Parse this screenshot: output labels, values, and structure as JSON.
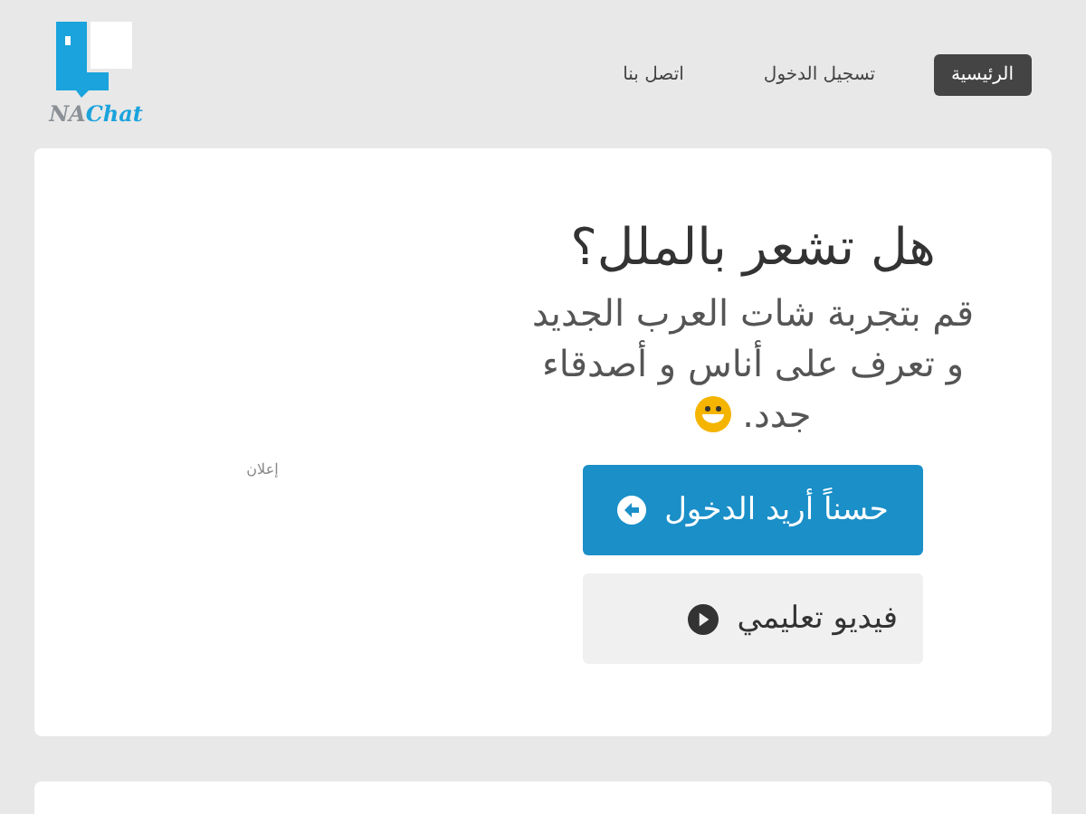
{
  "logo": {
    "prefix": "NA",
    "name": "Chat"
  },
  "nav": [
    {
      "label": "الرئيسية",
      "selected": true
    },
    {
      "label": "تسجيل الدخول",
      "selected": false
    },
    {
      "label": "اتصل بنا",
      "selected": false
    }
  ],
  "hero": {
    "title": "هل تشعر بالملل؟",
    "subtitle": "قم بتجربة شات العرب الجديد و تعرف على أناس و أصدقاء جدد.",
    "ad_label": "إعلان",
    "buttons": [
      {
        "label": "حسناً أريد الدخول",
        "kind": "primary"
      },
      {
        "label": "فيديو تعليمي",
        "kind": "video"
      }
    ]
  }
}
